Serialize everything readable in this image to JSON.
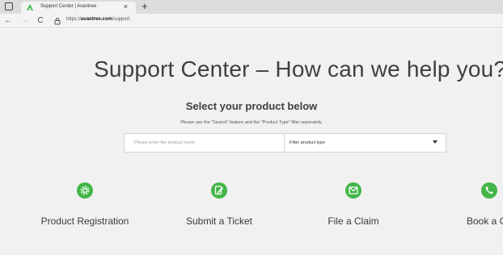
{
  "browser": {
    "tab_title": "Support Center | Avantree",
    "tab_close": "×",
    "new_tab": "+",
    "nav": {
      "back": "←",
      "forward": "→",
      "reload": "C"
    },
    "url_prefix": "https://",
    "url_domain": "avantree.com",
    "url_path": "/support",
    "favicon_color": "#39b54a"
  },
  "page": {
    "headline": "Support Center – How can we help you?",
    "subtitle": "Select your product below",
    "hint": "Please use the \"Search\" feature and the \"Product Type\" filter seperately.",
    "search": {
      "placeholder": "Please enter the product name"
    },
    "filter": {
      "value": "Filter product type"
    },
    "accent_color": "#43b649"
  },
  "cards": [
    {
      "label": "Product Registration",
      "icon": "gear-icon"
    },
    {
      "label": "Submit a Ticket",
      "icon": "edit-icon"
    },
    {
      "label": "File a Claim",
      "icon": "claim-icon"
    },
    {
      "label": "Book a Ca",
      "icon": "phone-icon"
    }
  ]
}
